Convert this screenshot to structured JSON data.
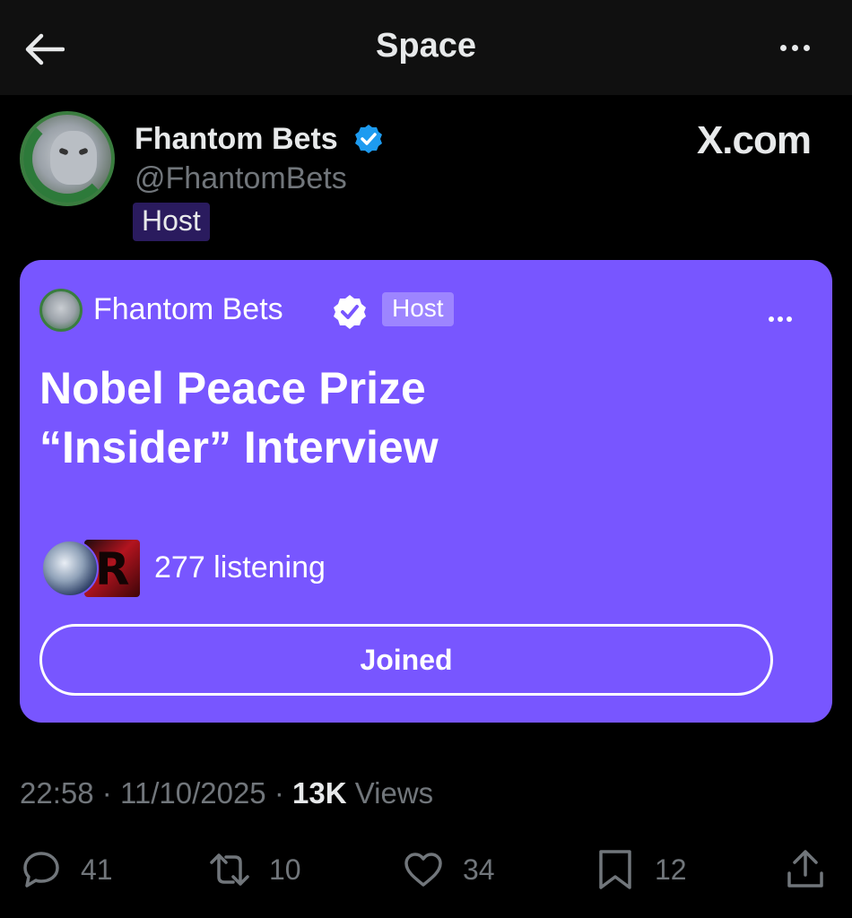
{
  "header": {
    "title": "Space",
    "back_icon": "arrow-left-icon",
    "more_icon": "more-horizontal-icon"
  },
  "author": {
    "name": "Fhantom Bets",
    "handle": "@FhantomBets",
    "role_badge": "Host",
    "verified": true,
    "watermark": "X.com"
  },
  "space_card": {
    "host_name": "Fhantom Bets",
    "host_badge": "Host",
    "title_line1": "Nobel Peace Prize",
    "title_line2": "“Insider” Interview",
    "listening_text": "277 listening",
    "join_button_label": "Joined",
    "background_color": "#7856ff"
  },
  "post_meta": {
    "time": "22:58",
    "separator": "·",
    "date": "11/10/2025",
    "views_count": "13K",
    "views_label": "Views"
  },
  "actions": {
    "replies": "41",
    "reposts": "10",
    "likes": "34",
    "bookmarks": "12"
  },
  "colors": {
    "background": "#000000",
    "topbar": "#101010",
    "text_primary": "#e7e9ea",
    "text_secondary": "#71767b",
    "verified_blue": "#1d9bf0",
    "host_badge_bg": "#2a1b5e"
  }
}
